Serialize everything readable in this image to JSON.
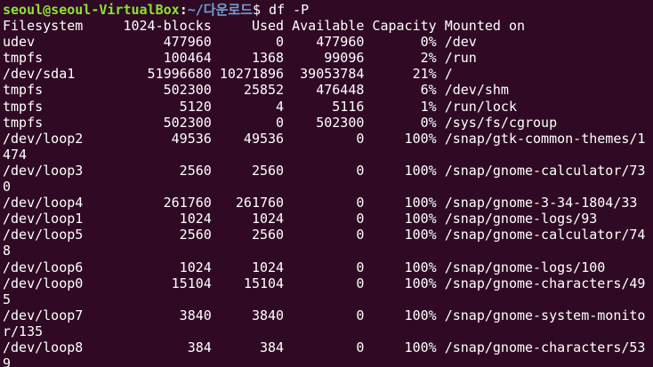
{
  "prompt": {
    "user_host": "seoul@seoul-VirtualBox",
    "separator": ":",
    "path": "~/다운로드",
    "symbol": "$",
    "command": " df -P"
  },
  "output_lines": [
    "Filesystem     1024-blocks     Used Available Capacity Mounted on",
    "udev                477960        0    477960       0% /dev",
    "tmpfs               100464     1368     99096       2% /run",
    "/dev/sda1         51996680 10271896  39053784      21% /",
    "tmpfs               502300    25852    476448       6% /dev/shm",
    "tmpfs                 5120        4      5116       1% /run/lock",
    "tmpfs               502300        0    502300       0% /sys/fs/cgroup",
    "/dev/loop2           49536    49536         0     100% /snap/gtk-common-themes/1",
    "474",
    "/dev/loop3            2560     2560         0     100% /snap/gnome-calculator/73",
    "0",
    "/dev/loop4          261760   261760         0     100% /snap/gnome-3-34-1804/33",
    "/dev/loop1            1024     1024         0     100% /snap/gnome-logs/93",
    "/dev/loop5            2560     2560         0     100% /snap/gnome-calculator/74",
    "8",
    "/dev/loop6            1024     1024         0     100% /snap/gnome-logs/100",
    "/dev/loop0           15104    15104         0     100% /snap/gnome-characters/49",
    "5",
    "/dev/loop7            3840     3840         0     100% /snap/gnome-system-monito",
    "r/135",
    "/dev/loop8             384      384         0     100% /snap/gnome-characters/53",
    "9"
  ],
  "colors": {
    "background": "#300a24",
    "user_host": "#8ae234",
    "path": "#729fcf",
    "text": "#ffffff"
  }
}
